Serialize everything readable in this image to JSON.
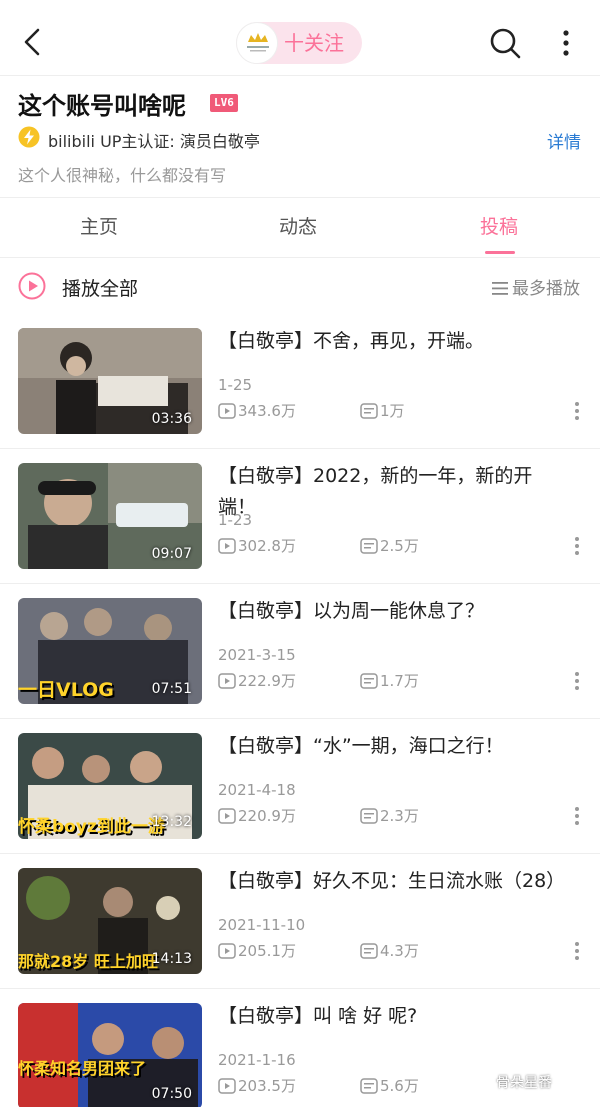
{
  "header": {
    "follow_label": "十关注"
  },
  "profile": {
    "name": "这个账号叫啥呢",
    "level": "LV6",
    "verification": "bilibili UP主认证: 演员白敬亭",
    "detail_label": "详情",
    "bio": "这个人很神秘，什么都没有写"
  },
  "tabs": [
    "主页",
    "动态",
    "投稿"
  ],
  "active_tab": "投稿",
  "playall": {
    "label": "播放全部",
    "sort_label": "最多播放"
  },
  "videos": [
    {
      "title": "【白敬亭】不舍，再见，开端。",
      "date": "1-25",
      "plays": "343.6万",
      "danmaku": "1万",
      "duration": "03:36",
      "overlay": ""
    },
    {
      "title": "【白敬亭】2022，新的一年，新的开端！",
      "date": "1-23",
      "plays": "302.8万",
      "danmaku": "2.5万",
      "duration": "09:07",
      "overlay": ""
    },
    {
      "title": "【白敬亭】以为周一能休息了？",
      "date": "2021-3-15",
      "plays": "222.9万",
      "danmaku": "1.7万",
      "duration": "07:51",
      "overlay": "一日VLOG"
    },
    {
      "title": "【白敬亭】“水”一期，海口之行！",
      "date": "2021-4-18",
      "plays": "220.9万",
      "danmaku": "2.3万",
      "duration": "13:32",
      "overlay": "怀柔boyz到此一游"
    },
    {
      "title": "【白敬亭】好久不见：生日流水账（28）",
      "date": "2021-11-10",
      "plays": "205.1万",
      "danmaku": "4.3万",
      "duration": "14:13",
      "overlay": "那就28岁 旺上加旺"
    },
    {
      "title": "【白敬亭】叫 啥 好 呢?",
      "date": "2021-1-16",
      "plays": "203.5万",
      "danmaku": "5.6万",
      "duration": "07:50",
      "overlay": "怀柔知名男团来了"
    }
  ],
  "watermark": "骨朵星番",
  "colors": {
    "accent": "#fb7299",
    "link": "#2a7bd3",
    "level_badge": "#f05a78",
    "verify": "#f7c325"
  }
}
